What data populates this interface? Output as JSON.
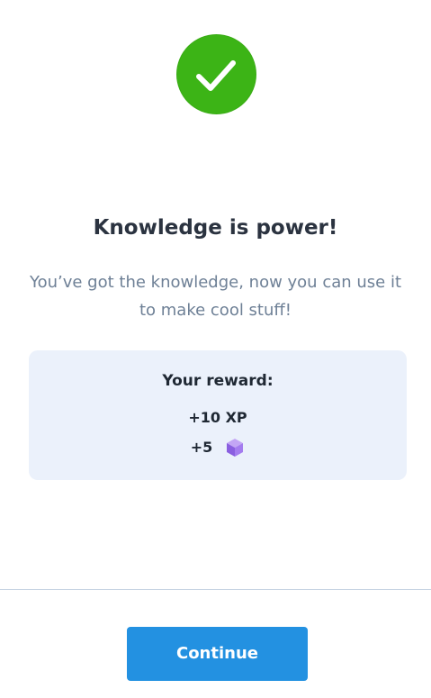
{
  "success": {
    "icon": "checkmark-icon",
    "color": "#3cb416"
  },
  "title": "Knowledge is power!",
  "subtitle": "You’ve got the knowledge, now you can use it to make cool stuff!",
  "reward": {
    "title": "Your reward:",
    "xp": "+10 XP",
    "gems": "+5",
    "gem_icon": "purple-gem-icon",
    "background": "#ebf1fb"
  },
  "footer": {
    "continue_label": "Continue",
    "button_color": "#2391e1"
  }
}
